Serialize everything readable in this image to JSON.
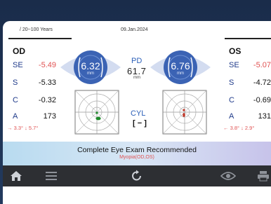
{
  "header": {
    "age_range": "/ 20~100 Years",
    "date": "09.Jan.2024"
  },
  "od": {
    "title": "OD",
    "rows": [
      {
        "label": "SE",
        "value": "-5.49"
      },
      {
        "label": "S",
        "value": "-5.33"
      },
      {
        "label": "C",
        "value": "-0.32"
      },
      {
        "label": "A",
        "value": "173"
      }
    ],
    "axis_info": "→ 3.3° ↓ 5.7°",
    "pupil": {
      "value": "6.32",
      "unit": "mm"
    }
  },
  "os": {
    "title": "OS",
    "rows": [
      {
        "label": "SE",
        "value": "-5.07"
      },
      {
        "label": "S",
        "value": "-4.72"
      },
      {
        "label": "C",
        "value": "-0.69"
      },
      {
        "label": "A",
        "value": "131"
      }
    ],
    "axis_info": "← 3.8° ↓ 2.9°",
    "pupil": {
      "value": "6.76",
      "unit": "mm"
    }
  },
  "center": {
    "pd_label": "PD",
    "pd_value": "61.7",
    "pd_unit": "mm",
    "cyl_label": "CYL",
    "cyl_value": "[ − ]"
  },
  "banner": {
    "main": "Complete Eye Exam Recommended",
    "sub": "Myopia(OD,OS)"
  },
  "nav": [
    "home-icon",
    "menu-icon",
    "refresh-icon",
    "eye-icon",
    "print-icon"
  ],
  "colors": {
    "accent": "#2b5fb8",
    "warning": "#e05252",
    "navbar": "#2d2f33",
    "target_dot_od": "#1f8a2b",
    "target_dot_os": "#c0392b"
  }
}
